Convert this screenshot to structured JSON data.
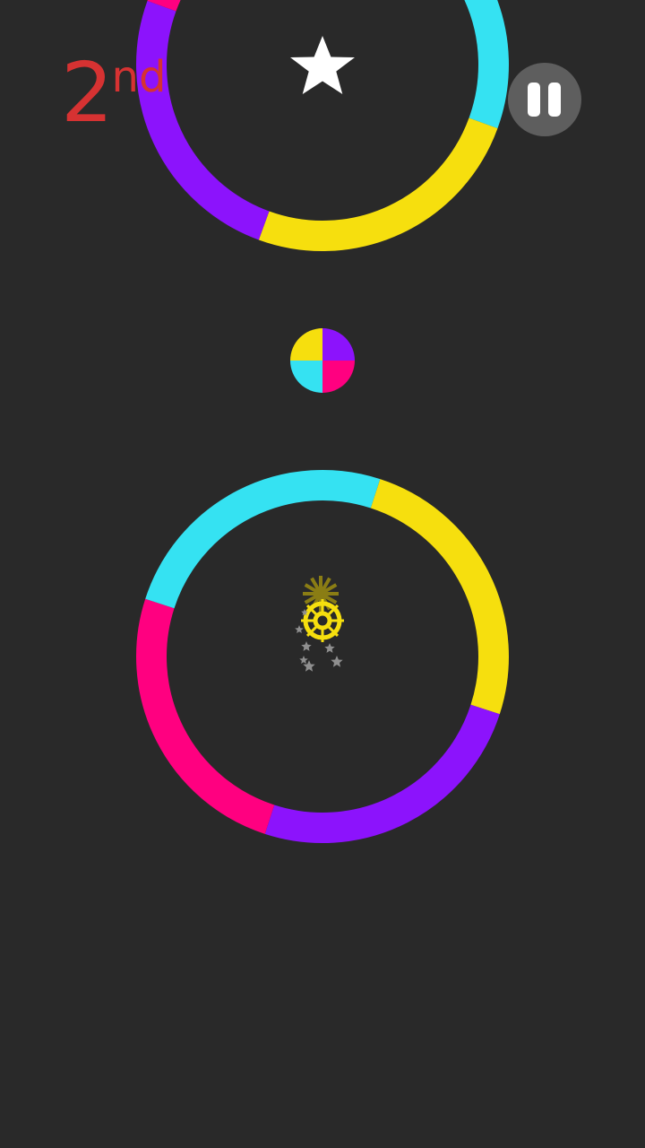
{
  "hud": {
    "rank_number": "2",
    "rank_suffix": "nd",
    "rank_color": "#d63232",
    "pause_icon": "pause-icon"
  },
  "palette": {
    "background": "#292929",
    "purple": "#8c13fc",
    "yellow": "#f6df0e",
    "cyan": "#35e2f2",
    "magenta": "#ff0080",
    "star": "#ffffff"
  },
  "objects": {
    "top_ring_colors": [
      "cyan",
      "yellow",
      "purple",
      "magenta"
    ],
    "bottom_ring_colors": [
      "yellow",
      "purple",
      "magenta",
      "cyan"
    ],
    "color_switcher_colors": [
      "purple",
      "magenta",
      "cyan",
      "yellow"
    ],
    "collectible_icon": "star-icon",
    "player_icon": "player-ball-icon"
  }
}
